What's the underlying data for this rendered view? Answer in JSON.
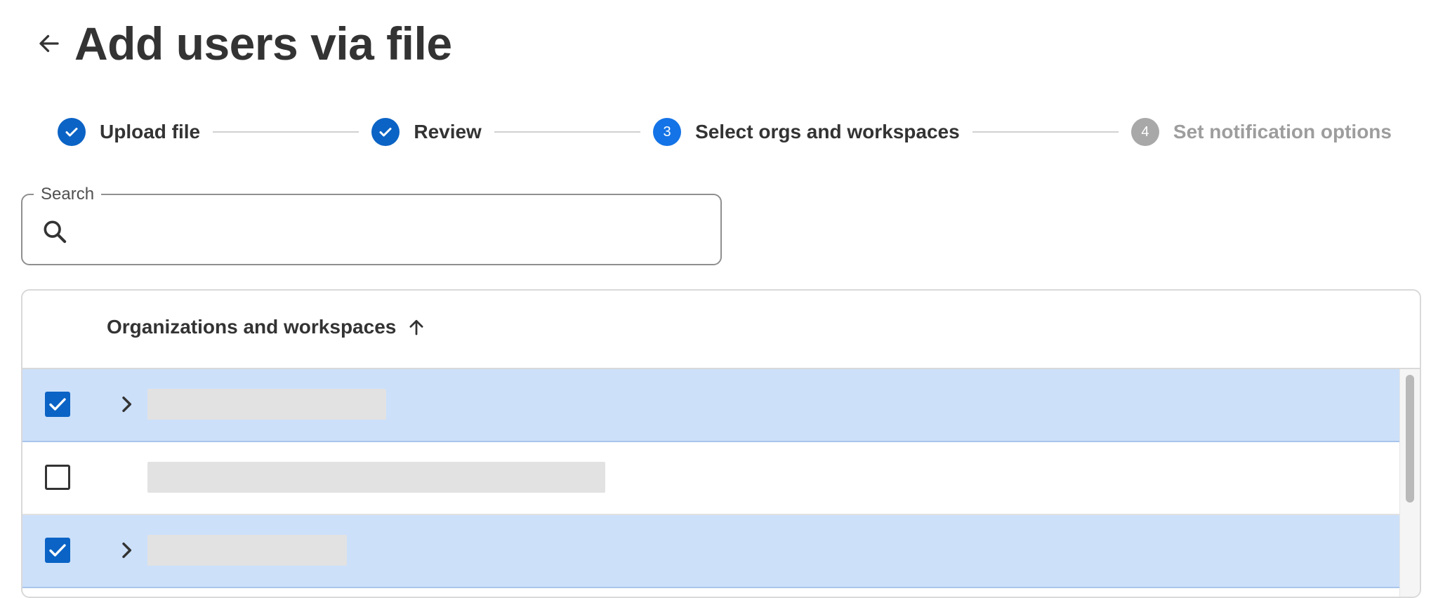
{
  "header": {
    "title": "Add users via file"
  },
  "stepper": {
    "steps": [
      {
        "number": "1",
        "label": "Upload file",
        "status": "done"
      },
      {
        "number": "2",
        "label": "Review",
        "status": "done"
      },
      {
        "number": "3",
        "label": "Select orgs and workspaces",
        "status": "active"
      },
      {
        "number": "4",
        "label": "Set notification options",
        "status": "pending"
      }
    ]
  },
  "search": {
    "label": "Search",
    "value": ""
  },
  "table": {
    "column_header": "Organizations and workspaces",
    "sort": "ascending",
    "rows": [
      {
        "checked": true,
        "expandable": true,
        "name_redacted": true
      },
      {
        "checked": false,
        "expandable": false,
        "name_redacted": true
      },
      {
        "checked": true,
        "expandable": true,
        "name_redacted": true
      }
    ]
  },
  "colors": {
    "accent": "#0b63c5",
    "active_step": "#1473e6",
    "pending_step": "#a8a8a8",
    "selected_row": "#cce0fa",
    "text": "#333333"
  },
  "icons": {
    "back": "arrow-left-icon",
    "done_step": "checkmark-icon",
    "search": "magnifier-icon",
    "sort": "arrow-up-icon",
    "expand": "chevron-right-icon"
  }
}
